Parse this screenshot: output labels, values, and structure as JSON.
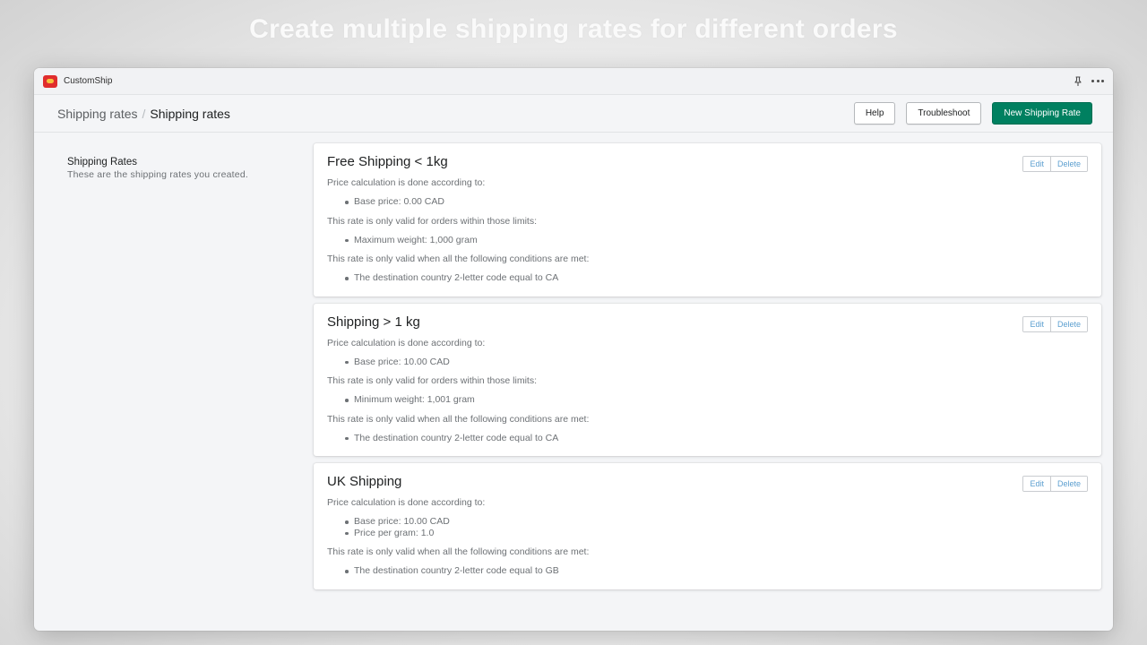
{
  "headline": "Create multiple shipping rates for different orders",
  "app": {
    "name": "CustomShip"
  },
  "breadcrumb": {
    "parent": "Shipping rates",
    "separator": "/",
    "current": "Shipping rates"
  },
  "header_actions": {
    "help": "Help",
    "troubleshoot": "Troubleshoot",
    "new_rate": "New Shipping Rate"
  },
  "aside": {
    "title": "Shipping Rates",
    "description": "These are the shipping rates you created."
  },
  "card_actions": {
    "edit": "Edit",
    "delete": "Delete"
  },
  "rates": [
    {
      "title": "Free Shipping < 1kg",
      "price_heading": "Price calculation is done according to:",
      "price_items": [
        "Base price: 0.00 CAD"
      ],
      "limits_heading": "This rate is only valid for orders within those limits:",
      "limit_items": [
        "Maximum weight: 1,000 gram"
      ],
      "conditions_heading": "This rate is only valid when all the following conditions are met:",
      "condition_items": [
        "The destination country 2-letter code equal to CA"
      ]
    },
    {
      "title": "Shipping > 1 kg",
      "price_heading": "Price calculation is done according to:",
      "price_items": [
        "Base price: 10.00 CAD"
      ],
      "limits_heading": "This rate is only valid for orders within those limits:",
      "limit_items": [
        "Minimum weight: 1,001 gram"
      ],
      "conditions_heading": "This rate is only valid when all the following conditions are met:",
      "condition_items": [
        "The destination country 2-letter code equal to CA"
      ]
    },
    {
      "title": "UK Shipping",
      "price_heading": "Price calculation is done according to:",
      "price_items": [
        "Base price: 10.00 CAD",
        "Price per gram: 1.0"
      ],
      "conditions_heading": "This rate is only valid when all the following conditions are met:",
      "condition_items": [
        "The destination country 2-letter code equal to GB"
      ]
    }
  ],
  "colors": {
    "primary": "#008060",
    "app_logo": "#e02d2d",
    "link": "#5c9fd0"
  },
  "icons": {
    "app_logo": "customship-logo-icon",
    "pin": "pin-icon",
    "more": "more-horizontal-icon"
  }
}
